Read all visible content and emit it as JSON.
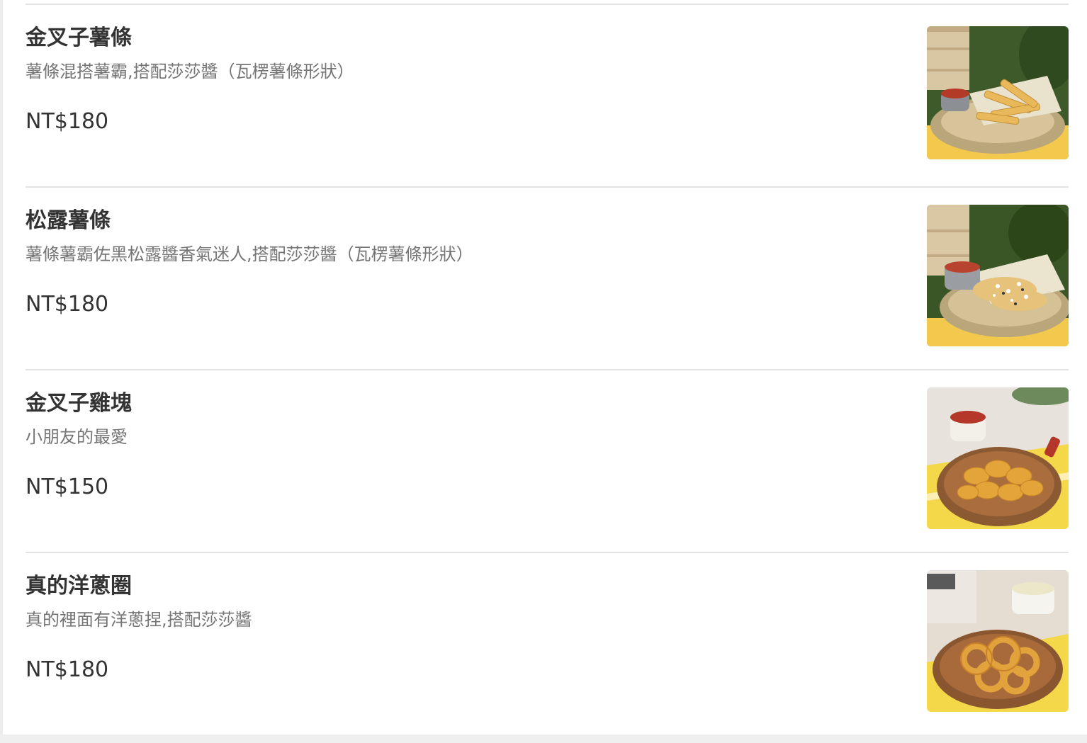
{
  "menu": {
    "items": [
      {
        "name": "金叉子薯條",
        "description": "薯條混搭薯霸,搭配莎莎醬（瓦楞薯條形狀）",
        "price": "NT$180",
        "image_icon": "fries-photo"
      },
      {
        "name": "松露薯條",
        "description": "薯條薯霸佐黑松露醬香氣迷人,搭配莎莎醬（瓦楞薯條形狀）",
        "price": "NT$180",
        "image_icon": "truffle-fries-photo"
      },
      {
        "name": "金叉子雞塊",
        "description": "小朋友的最愛",
        "price": "NT$150",
        "image_icon": "chicken-nuggets-photo"
      },
      {
        "name": "真的洋蔥圈",
        "description": "真的裡面有洋蔥捏,搭配莎莎醬",
        "price": "NT$180",
        "image_icon": "onion-rings-photo"
      }
    ]
  },
  "colors": {
    "title": "#333333",
    "description": "#757575",
    "divider": "#e3e3e3"
  }
}
